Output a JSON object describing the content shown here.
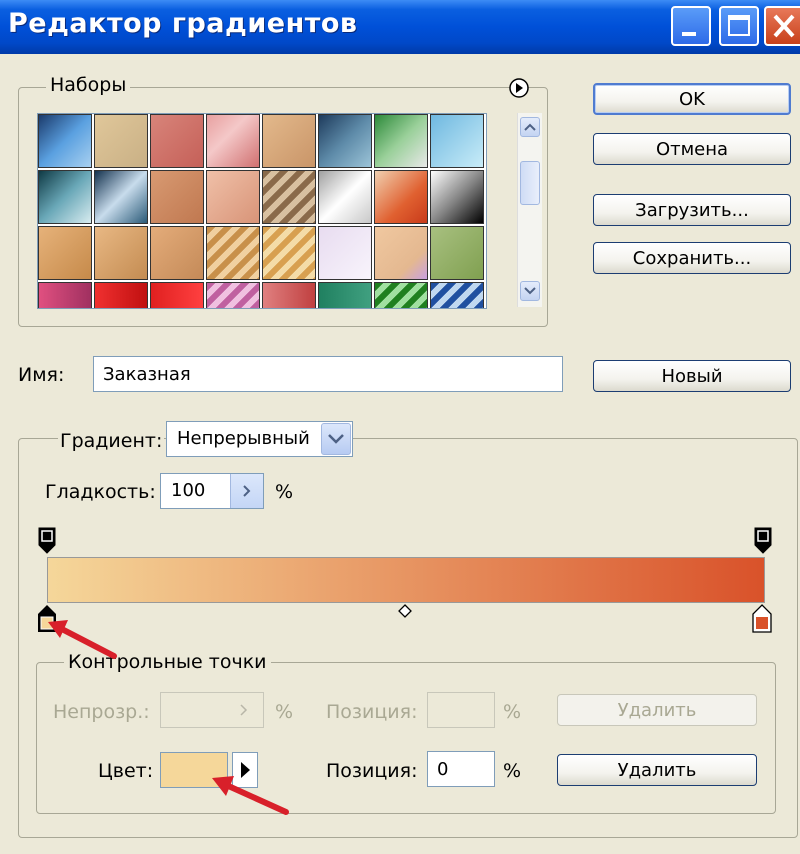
{
  "window": {
    "title": "Редактор градиентов"
  },
  "presets": {
    "label": "Наборы"
  },
  "buttons": {
    "ok": "OK",
    "cancel": "Отмена",
    "load": "Загрузить...",
    "save": "Сохранить...",
    "new": "Новый"
  },
  "name": {
    "label": "Имя:",
    "value": "Заказная"
  },
  "gradient": {
    "type_label": "Градиент:",
    "type_value": "Непрерывный",
    "smoothness_label": "Гладкость:",
    "smoothness_value": "100",
    "smoothness_unit": "%",
    "start_color": "#f5d79a",
    "end_color": "#d9522a"
  },
  "stops": {
    "label": "Контрольные точки",
    "opacity_label": "Непрозр.:",
    "opacity_unit": "%",
    "opacity_position_label": "Позиция:",
    "opacity_position_unit": "%",
    "opacity_delete": "Удалить",
    "color_label": "Цвет:",
    "color_value": "#f5d79a",
    "color_position_label": "Позиция:",
    "color_position_value": "0",
    "color_position_unit": "%",
    "color_delete": "Удалить"
  },
  "colors": {
    "accent": "#0050d8",
    "annotation": "#d8202a"
  }
}
